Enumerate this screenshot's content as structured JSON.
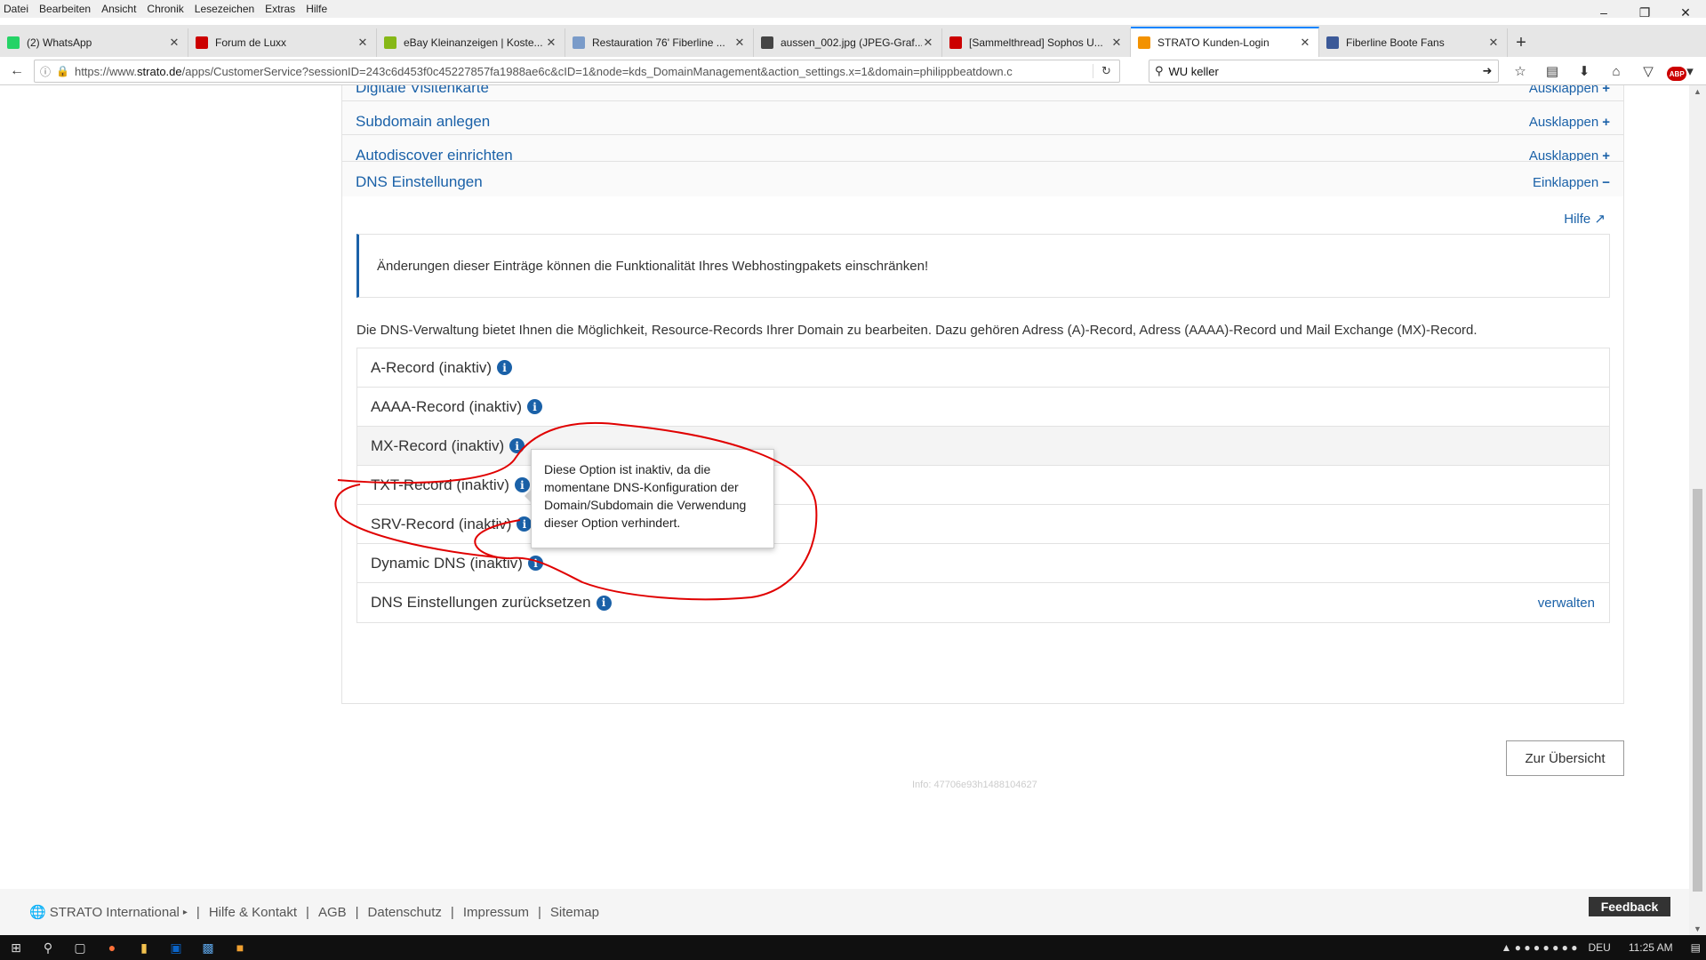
{
  "menu": [
    "Datei",
    "Bearbeiten",
    "Ansicht",
    "Chronik",
    "Lesezeichen",
    "Extras",
    "Hilfe"
  ],
  "tabs": [
    {
      "title": "(2) WhatsApp",
      "icon": "whatsapp-icon",
      "color": "#25d366"
    },
    {
      "title": "Forum de Luxx",
      "icon": "luxx-icon",
      "color": "#c00"
    },
    {
      "title": "eBay Kleinanzeigen | Koste...",
      "icon": "ebay-icon",
      "color": "#86b817"
    },
    {
      "title": "Restauration 76' Fiberline ...",
      "icon": "page-icon",
      "color": "#7a9bc9"
    },
    {
      "title": "aussen_002.jpg (JPEG-Graf...",
      "icon": "image-icon",
      "color": "#444"
    },
    {
      "title": "[Sammelthread] Sophos U...",
      "icon": "luxx-icon",
      "color": "#c00"
    },
    {
      "title": "STRATO Kunden-Login",
      "icon": "strato-icon",
      "color": "#f39200",
      "active": true
    },
    {
      "title": "Fiberline Boote Fans",
      "icon": "facebook-icon",
      "color": "#3b5998"
    }
  ],
  "url": {
    "prefix": "https://www.",
    "host": "strato.de",
    "path": "/apps/CustomerService?sessionID=243c6d453f0c45227857fa1988ae6c&cID=1&node=kds_DomainManagement&action_settings.x=1&domain=philippbeatdown.c"
  },
  "search": {
    "value": "WU keller"
  },
  "panels": [
    {
      "title": "Digitale Visitenkarte",
      "action": "Ausklappen",
      "sign": "+"
    },
    {
      "title": "Subdomain anlegen",
      "action": "Ausklappen",
      "sign": "+"
    },
    {
      "title": "Autodiscover einrichten",
      "action": "Ausklappen",
      "sign": "+"
    },
    {
      "title": "DNS Einstellungen",
      "action": "Einklappen",
      "sign": "−"
    }
  ],
  "dns": {
    "help": "Hilfe",
    "alert": "Änderungen dieser Einträge können die Funktionalität Ihres Webhostingpakets einschränken!",
    "intro": "Die DNS-Verwaltung bietet Ihnen die Möglichkeit, Resource-Records Ihrer Domain zu bearbeiten. Dazu gehören Adress (A)-Record, Adress (AAAA)-Record und Mail Exchange (MX)-Record.",
    "records": [
      {
        "label": "A-Record (inaktiv)"
      },
      {
        "label": "AAAA-Record (inaktiv)"
      },
      {
        "label": "MX-Record (inaktiv)"
      },
      {
        "label": "TXT-Record (inaktiv)"
      },
      {
        "label": "SRV-Record (inaktiv)"
      },
      {
        "label": "Dynamic DNS (inaktiv)"
      },
      {
        "label": "DNS Einstellungen zurücksetzen",
        "action": "verwalten"
      }
    ],
    "tooltip": "Diese Option ist inaktiv, da die momentane DNS-Konfiguration der Domain/Subdomain die Verwendung dieser Option verhindert."
  },
  "overview_button": "Zur Übersicht",
  "info_id": "Info: 47706e93h1488104627",
  "footer": {
    "brand": "STRATO International",
    "links": [
      "Hilfe & Kontakt",
      "AGB",
      "Datenschutz",
      "Impressum",
      "Sitemap"
    ],
    "feedback": "Feedback"
  },
  "taskbar": {
    "lang": "DEU",
    "time": "11:25 AM"
  },
  "colors": {
    "accent": "#1a61a8",
    "annotation": "#e00000"
  }
}
